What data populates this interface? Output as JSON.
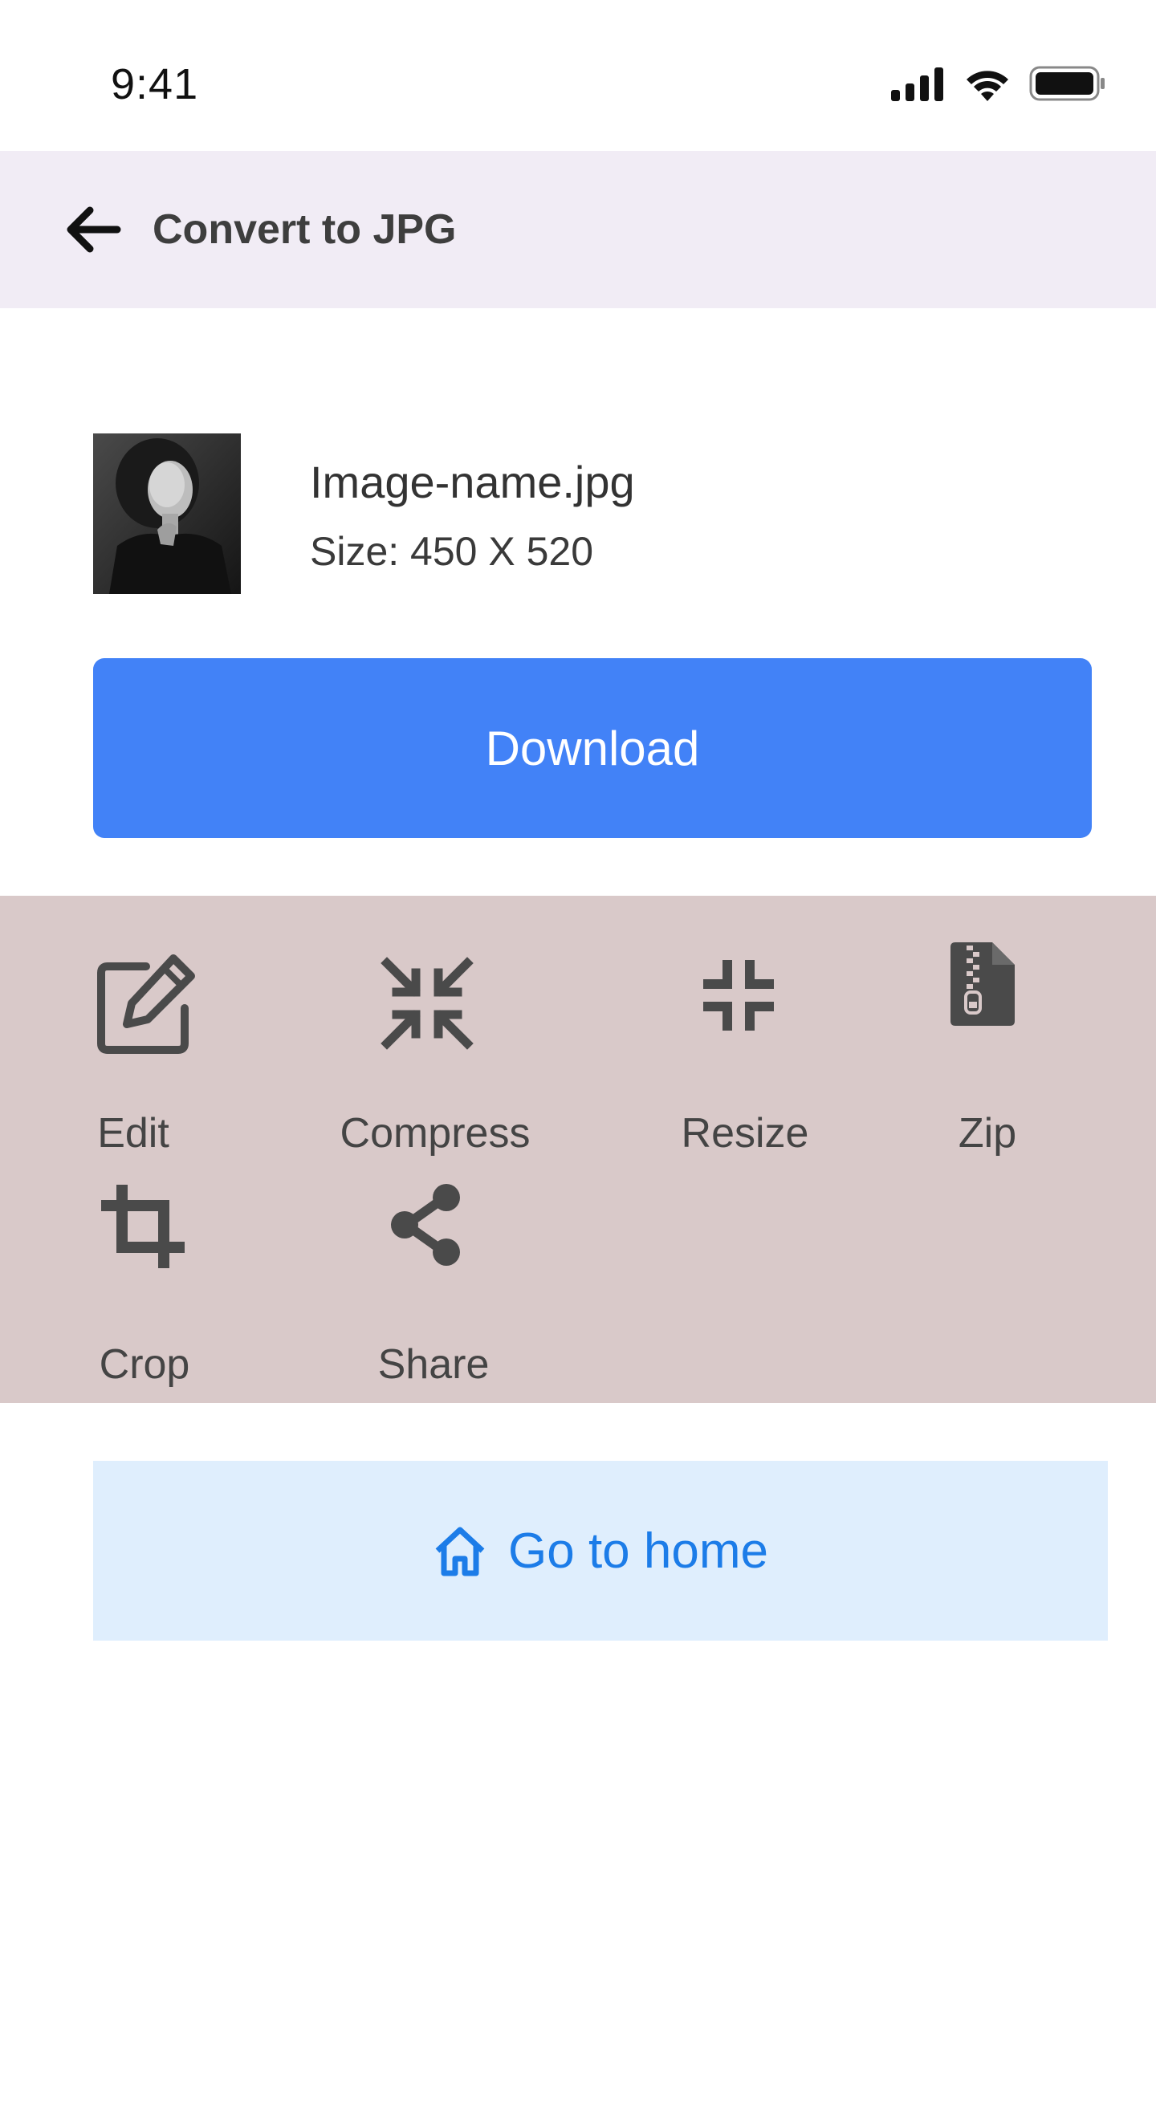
{
  "status_bar": {
    "time": "9:41",
    "icons": [
      "signal-icon",
      "wifi-icon",
      "battery-icon"
    ]
  },
  "header": {
    "back_icon": "arrow-left-icon",
    "title": "Convert to JPG"
  },
  "file": {
    "name": "Image-name.jpg",
    "size": "Size: 450 X 520"
  },
  "download_button": {
    "label": "Download"
  },
  "tools": [
    {
      "label": "Edit",
      "icon": "edit-icon"
    },
    {
      "label": "Compress",
      "icon": "compress-icon"
    },
    {
      "label": "Resize",
      "icon": "resize-icon"
    },
    {
      "label": "Zip",
      "icon": "zip-file-icon"
    },
    {
      "label": "Crop",
      "icon": "crop-icon"
    },
    {
      "label": "Share",
      "icon": "share-icon"
    }
  ],
  "home_button": {
    "label": "Go to home",
    "icon": "home-icon"
  },
  "colors": {
    "header_bg": "#f1ecf5",
    "download_bg": "#4282f7",
    "tools_bg": "#d9c9c9",
    "home_bg": "#dfeefd",
    "home_text": "#1c7ce8",
    "icon_color": "#4a4a4a"
  }
}
